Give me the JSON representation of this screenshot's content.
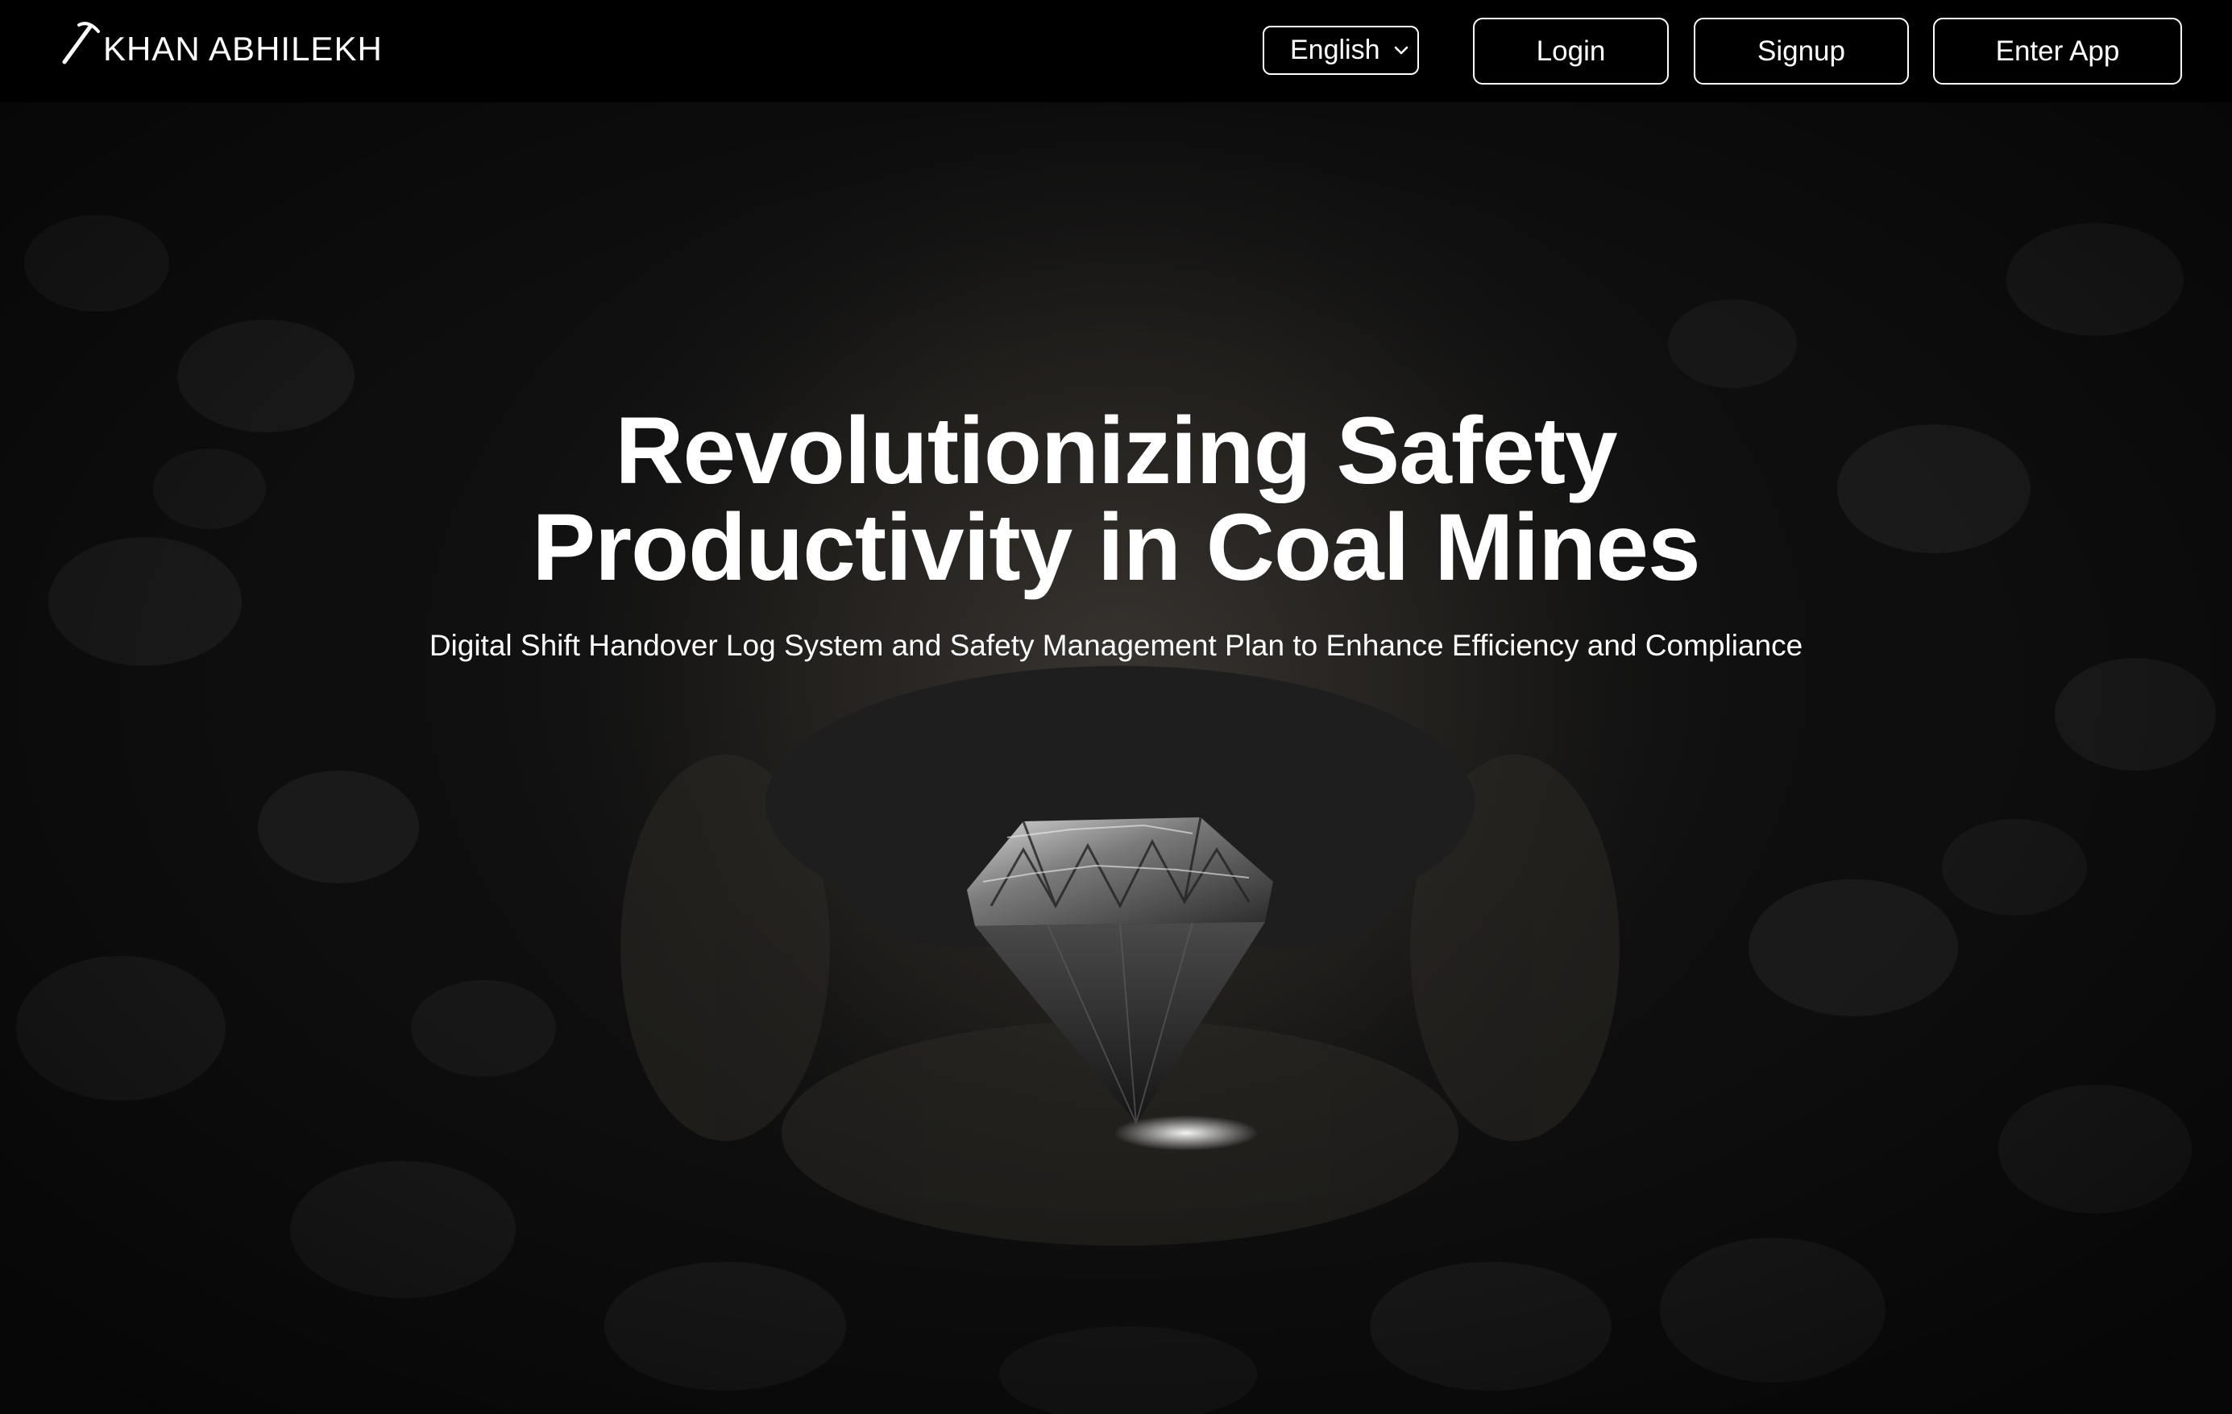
{
  "brand": {
    "name": "KHAN ABHILEKH",
    "logo_icon": "pickaxe-icon"
  },
  "nav": {
    "language": {
      "selected": "English",
      "icon": "chevron-down-icon"
    },
    "login_label": "Login",
    "signup_label": "Signup",
    "enter_app_label": "Enter App"
  },
  "hero": {
    "title_line1": "Revolutionizing Safety",
    "title_line2": "Productivity in Coal Mines",
    "subtitle": "Digital Shift Handover Log System and Safety Management Plan to Enhance Efficiency and Compliance",
    "image": "coal-diamond-in-hands"
  },
  "colors": {
    "navbar_bg": "#000000",
    "text": "#ffffff",
    "hero_bg": "#121212"
  }
}
